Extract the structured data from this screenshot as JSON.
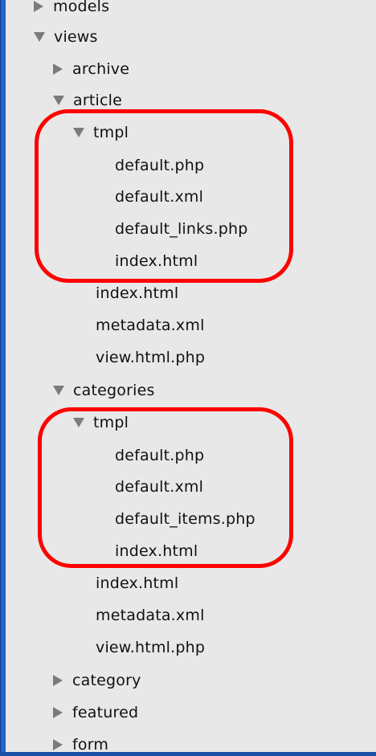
{
  "tree": {
    "models_label": "models",
    "views_label": "views",
    "archive_label": "archive",
    "article": {
      "label": "article",
      "tmpl_label": "tmpl",
      "tmpl_files": [
        "default.php",
        "default.xml",
        "default_links.php",
        "index.html"
      ],
      "files": [
        "index.html",
        "metadata.xml",
        "view.html.php"
      ]
    },
    "categories": {
      "label": "categories",
      "tmpl_label": "tmpl",
      "tmpl_files": [
        "default.php",
        "default.xml",
        "default_items.php",
        "index.html"
      ],
      "files": [
        "index.html",
        "metadata.xml",
        "view.html.php"
      ]
    },
    "category_label": "category",
    "featured_label": "featured",
    "form_label": "form"
  },
  "colors": {
    "highlight": "#ff0000",
    "panel_bg": "#e8e8e8",
    "frame": "#1a5ab8",
    "arrow": "#7b7b7b"
  }
}
